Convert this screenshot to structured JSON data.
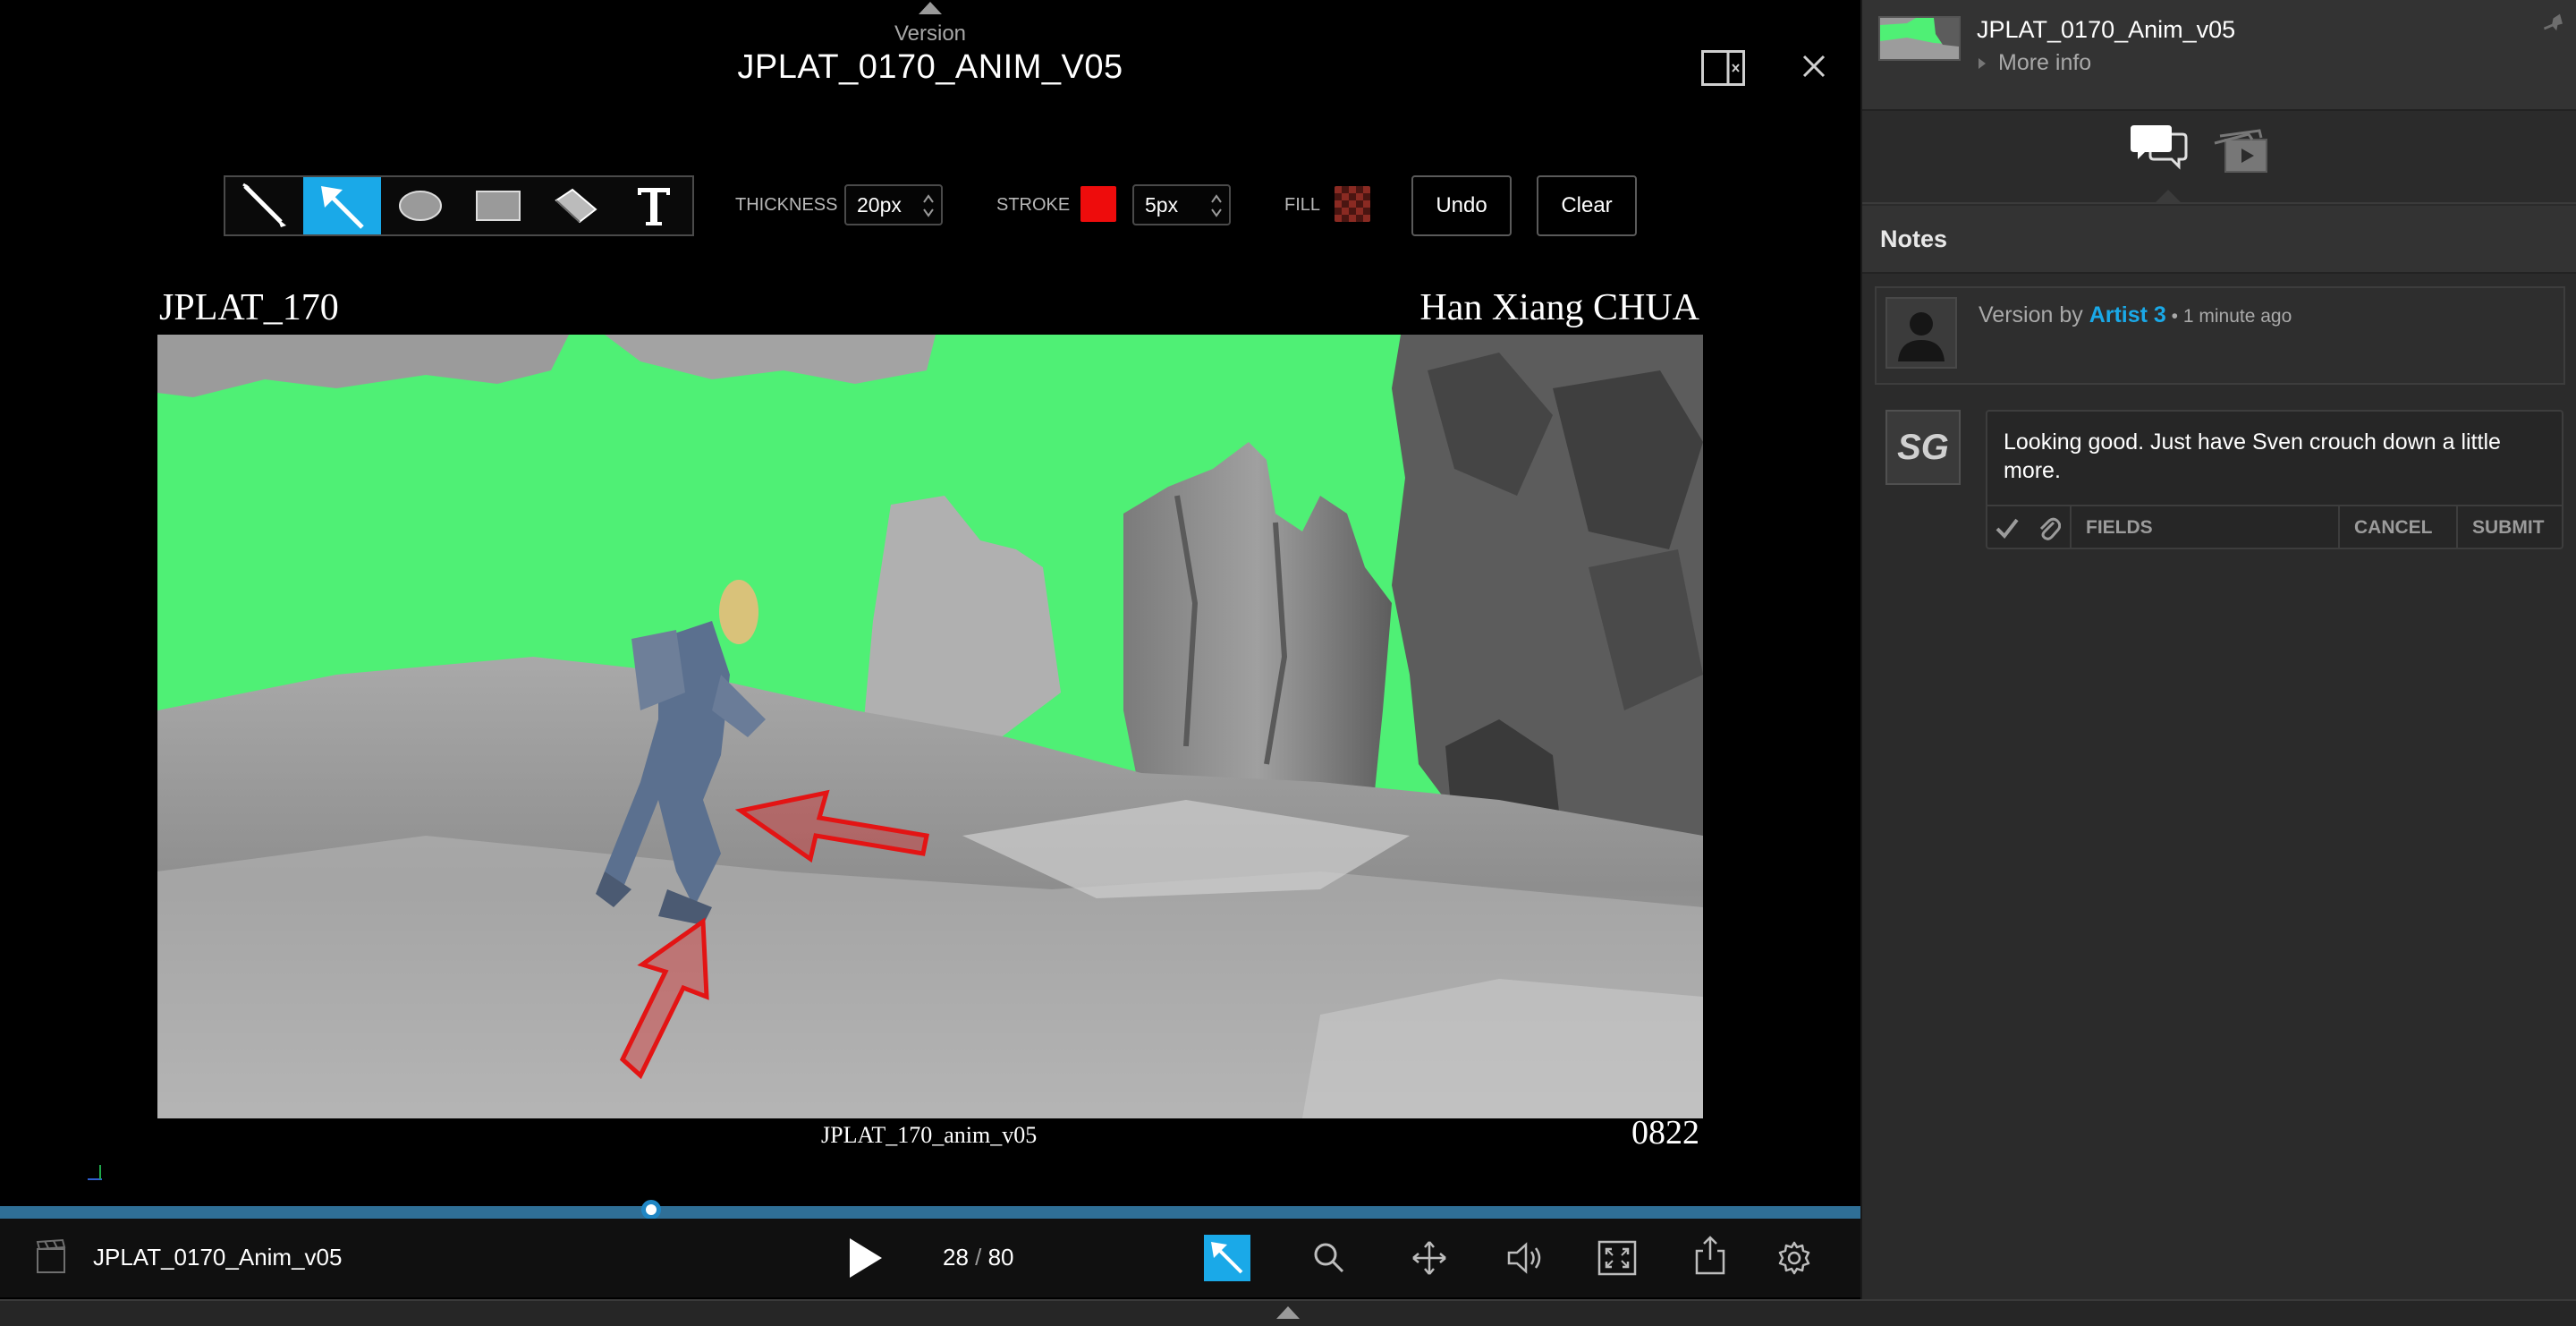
{
  "version": {
    "caption": "Version",
    "title": "JPLAT_0170_ANIM_V05"
  },
  "toolbar": {
    "thickness_label": "THICKNESS",
    "thickness_value": "20px",
    "stroke_label": "STROKE",
    "stroke_value": "5px",
    "stroke_color": "#ee0c0c",
    "fill_label": "FILL",
    "undo_label": "Undo",
    "clear_label": "Clear",
    "active_tool": "arrow",
    "accent_color": "#1aa9e8"
  },
  "frame": {
    "top_left": "JPLAT_170",
    "top_right": "Han Xiang CHUA",
    "bottom_center": "JPLAT_170_anim_v05",
    "bottom_right": "0822"
  },
  "player": {
    "clip_name": "JPLAT_0170_Anim_v05",
    "current_frame": "28",
    "separator": " / ",
    "total_frames": "80",
    "progress_fraction": 0.35
  },
  "sidebar": {
    "entity_title": "JPLAT_0170_Anim_v05",
    "more_info": "More info",
    "notes_heading": "Notes",
    "activity": {
      "prefix": "Version by ",
      "user": "Artist 3",
      "time": " • 1 minute ago"
    },
    "avatar_initials": "SG",
    "note_text": "Looking good. Just have Sven crouch down a little more.",
    "fields_label": "FIELDS",
    "cancel_label": "CANCEL",
    "submit_label": "SUBMIT",
    "link_color": "#1aa9e8"
  }
}
